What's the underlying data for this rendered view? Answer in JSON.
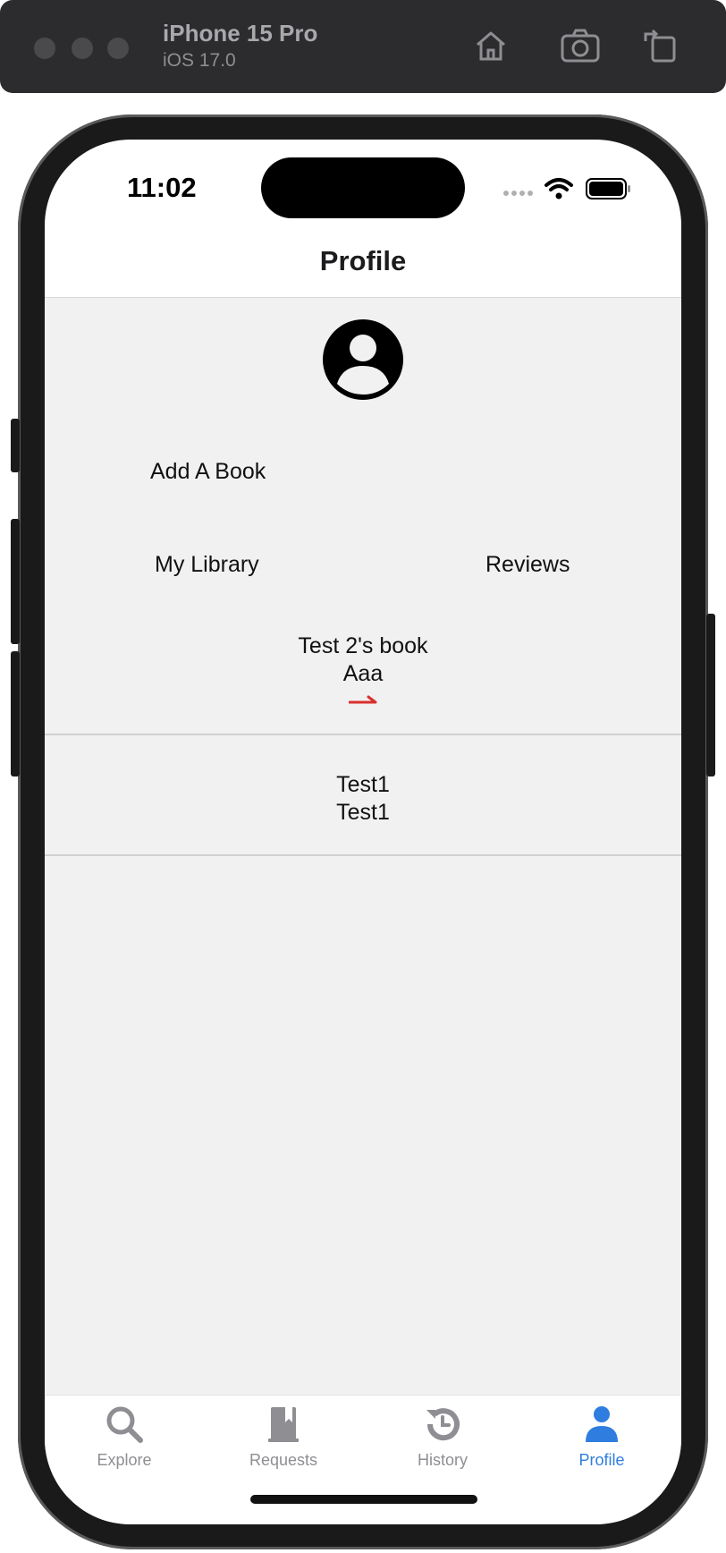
{
  "simulator": {
    "device_name": "iPhone 15 Pro",
    "os_version": "iOS 17.0",
    "buttons": [
      "home-icon",
      "screenshot-icon",
      "rotate-icon"
    ]
  },
  "status_bar": {
    "time": "11:02"
  },
  "header": {
    "title": "Profile"
  },
  "profile": {
    "avatar_icon": "person-circle-icon",
    "add_book_label": "Add A Book",
    "my_library_label": "My Library",
    "reviews_label": "Reviews"
  },
  "books": [
    {
      "title": "Test 2's book",
      "author": "Aaa"
    },
    {
      "title": "Test1",
      "author": "Test1"
    }
  ],
  "tabs": [
    {
      "label": "Explore",
      "icon": "search-icon",
      "active": false
    },
    {
      "label": "Requests",
      "icon": "book-icon",
      "active": false
    },
    {
      "label": "History",
      "icon": "history-icon",
      "active": false
    },
    {
      "label": "Profile",
      "icon": "person-icon",
      "active": true
    }
  ],
  "colors": {
    "accent": "#2f7ddf",
    "content_bg": "#f1f1f1",
    "inactive_tab": "#8e8e93",
    "arrow": "#d9302c"
  }
}
